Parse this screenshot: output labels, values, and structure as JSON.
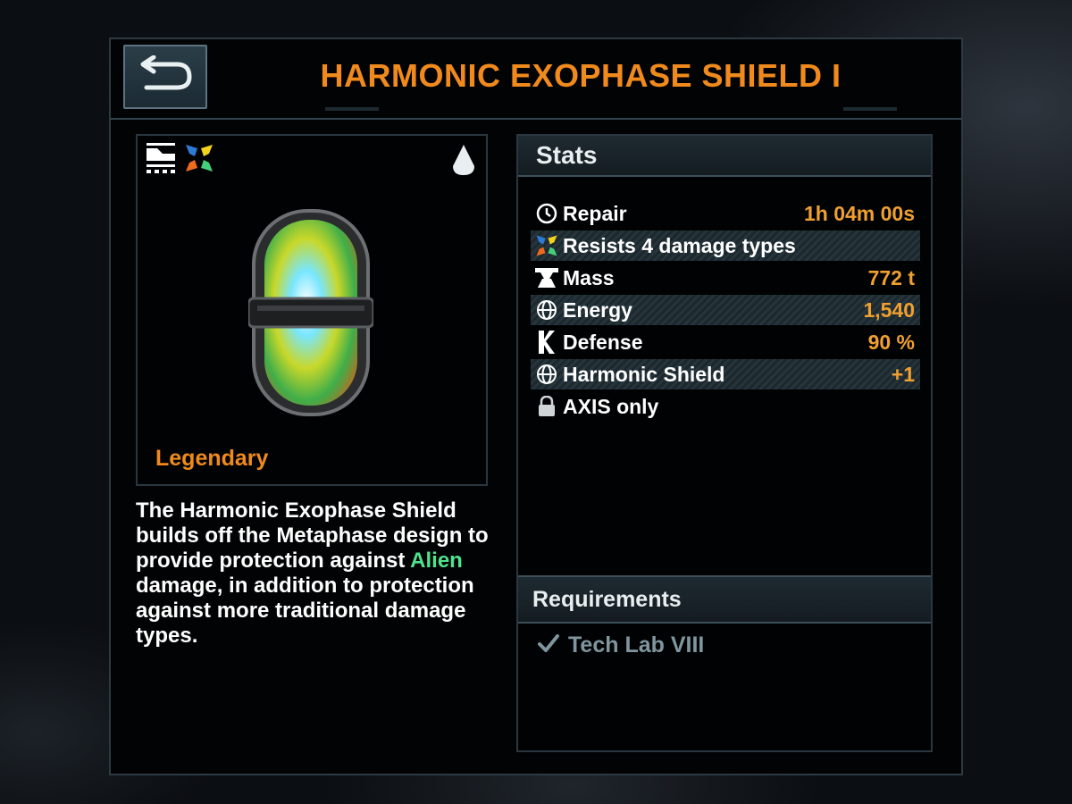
{
  "header": {
    "title": "HARMONIC EXOPHASE SHIELD I",
    "back_icon": "back-arrow-icon"
  },
  "item": {
    "rarity": "Legendary",
    "badges": [
      "module-type-icon",
      "resist-types-icon",
      "tier-drop-icon"
    ],
    "description_before": "The Harmonic Exophase Shield builds off the Metaphase design to provide protection against ",
    "description_highlight": "Alien",
    "description_after": " damage, in addition to protection against more traditional damage types."
  },
  "stats": {
    "title": "Stats",
    "rows": [
      {
        "icon": "clock-icon",
        "label": "Repair",
        "value": "1h 04m 00s"
      },
      {
        "icon": "resist-types-icon",
        "label": "Resists 4 damage types",
        "value": ""
      },
      {
        "icon": "anvil-icon",
        "label": "Mass",
        "value": "772 t"
      },
      {
        "icon": "globe-icon",
        "label": "Energy",
        "value": "1,540"
      },
      {
        "icon": "defense-icon",
        "label": "Defense",
        "value": "90 %"
      },
      {
        "icon": "globe-icon",
        "label": "Harmonic Shield",
        "value": "+1"
      },
      {
        "icon": "lock-icon",
        "label": "AXIS only",
        "value": ""
      }
    ]
  },
  "requirements": {
    "title": "Requirements",
    "items": [
      {
        "icon": "checkmark-icon",
        "label": "Tech Lab VIII"
      }
    ]
  },
  "colors": {
    "accent_orange": "#f08a1c",
    "alien_green": "#4fe38d",
    "requirement_gray": "#7f969f"
  }
}
